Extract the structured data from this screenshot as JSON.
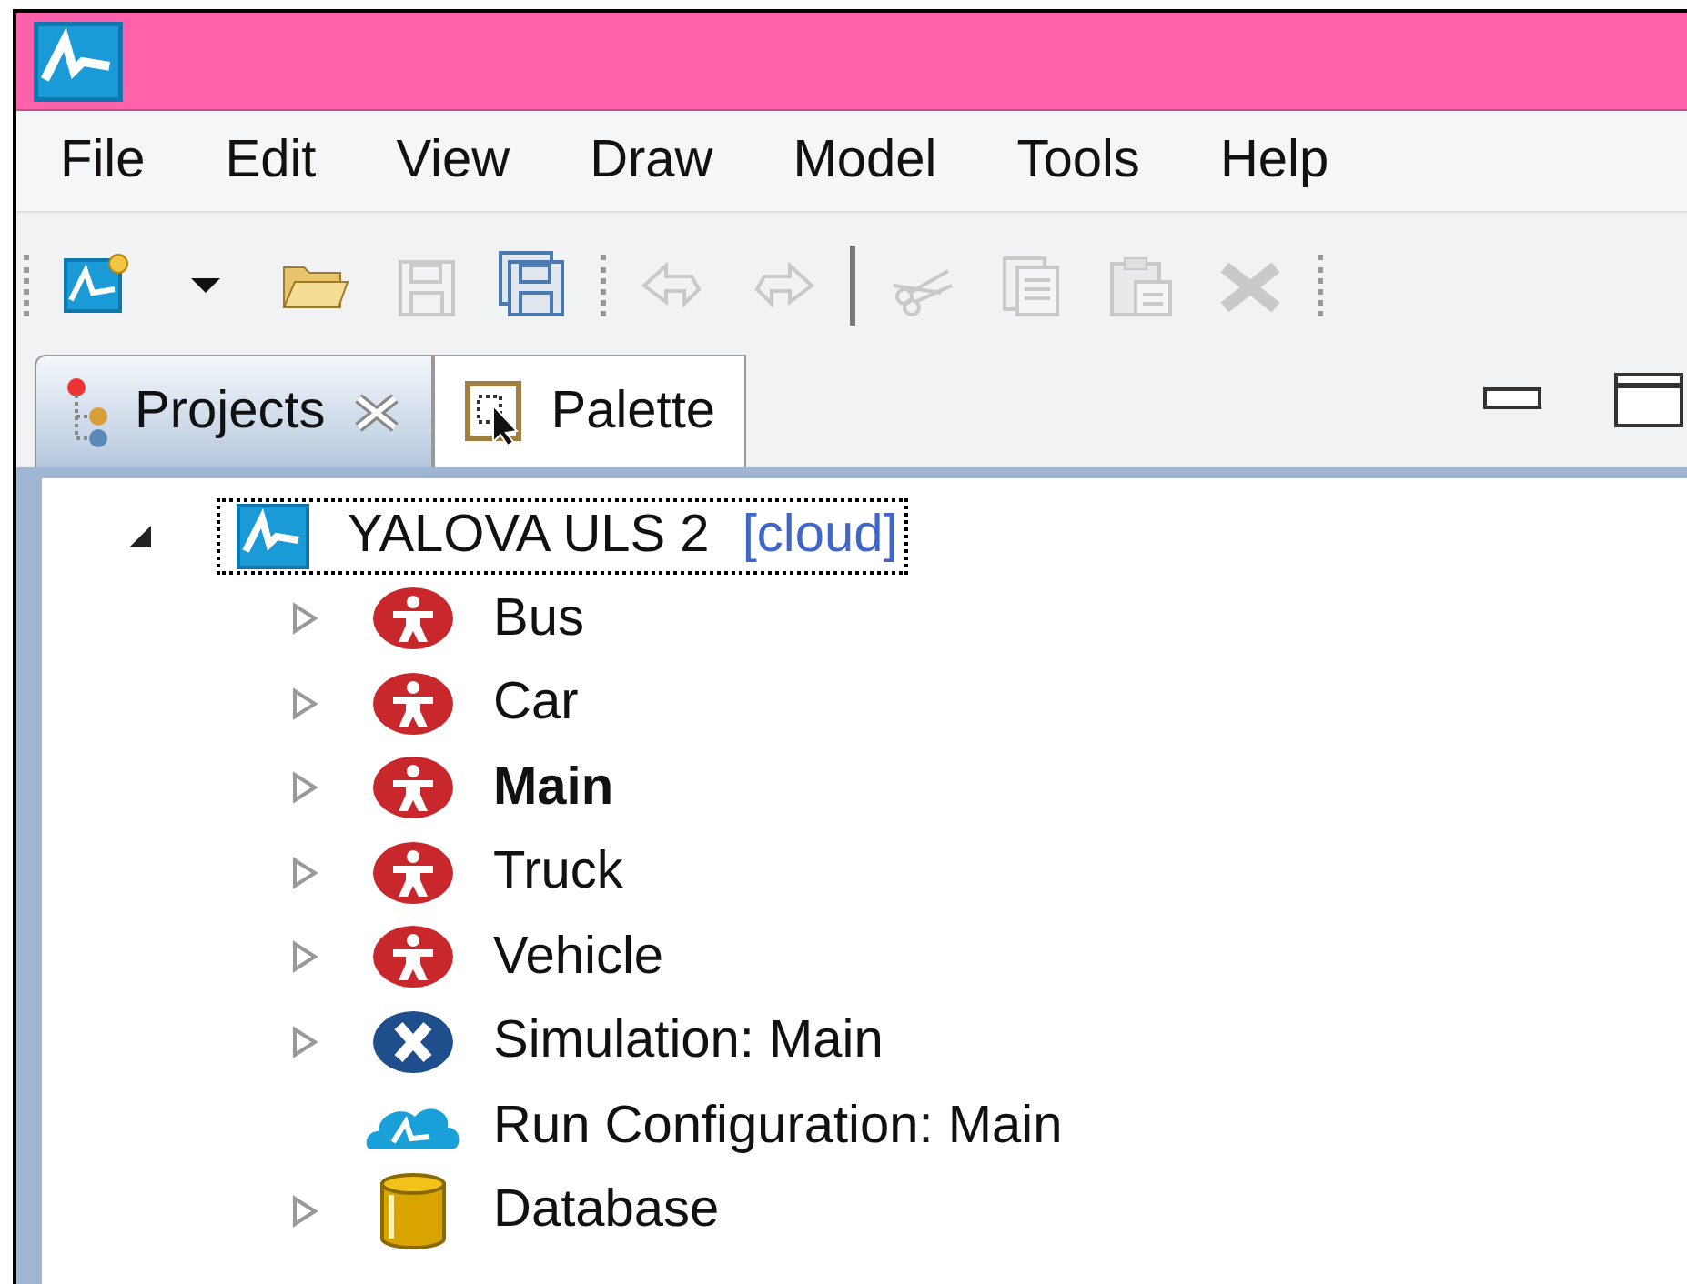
{
  "menu": [
    "File",
    "Edit",
    "View",
    "Draw",
    "Model",
    "Tools",
    "Help"
  ],
  "toolbar": [
    {
      "kind": "new",
      "disabled": false
    },
    {
      "kind": "dropdown",
      "disabled": false
    },
    {
      "kind": "open",
      "disabled": false
    },
    {
      "kind": "save",
      "disabled": true
    },
    {
      "kind": "save-all",
      "disabled": false
    },
    {
      "kind": "separator"
    },
    {
      "kind": "undo",
      "disabled": true
    },
    {
      "kind": "redo",
      "disabled": true
    },
    {
      "kind": "rule"
    },
    {
      "kind": "cut",
      "disabled": true
    },
    {
      "kind": "copy",
      "disabled": true
    },
    {
      "kind": "paste",
      "disabled": true
    },
    {
      "kind": "delete",
      "disabled": true
    },
    {
      "kind": "separator"
    }
  ],
  "tabs": [
    {
      "label": "Projects",
      "kind": "projects",
      "selected": true,
      "closable": true
    },
    {
      "label": "Palette",
      "kind": "palette",
      "selected": false,
      "closable": false
    }
  ],
  "tree": {
    "label": "YALOVA ULS 2",
    "tag": "[cloud]",
    "kind": "model",
    "expanded": true,
    "focused": true,
    "children": [
      {
        "label": "Bus",
        "kind": "agent",
        "bold": false,
        "expandable": true
      },
      {
        "label": "Car",
        "kind": "agent",
        "bold": false,
        "expandable": true
      },
      {
        "label": "Main",
        "kind": "agent",
        "bold": true,
        "expandable": true
      },
      {
        "label": "Truck",
        "kind": "agent",
        "bold": false,
        "expandable": true
      },
      {
        "label": "Vehicle",
        "kind": "agent",
        "bold": false,
        "expandable": true
      },
      {
        "label": "Simulation: Main",
        "kind": "simulation",
        "bold": false,
        "expandable": true
      },
      {
        "label": "Run Configuration: Main",
        "kind": "run",
        "bold": false,
        "expandable": false
      },
      {
        "label": "Database",
        "kind": "database",
        "bold": false,
        "expandable": true
      }
    ]
  }
}
